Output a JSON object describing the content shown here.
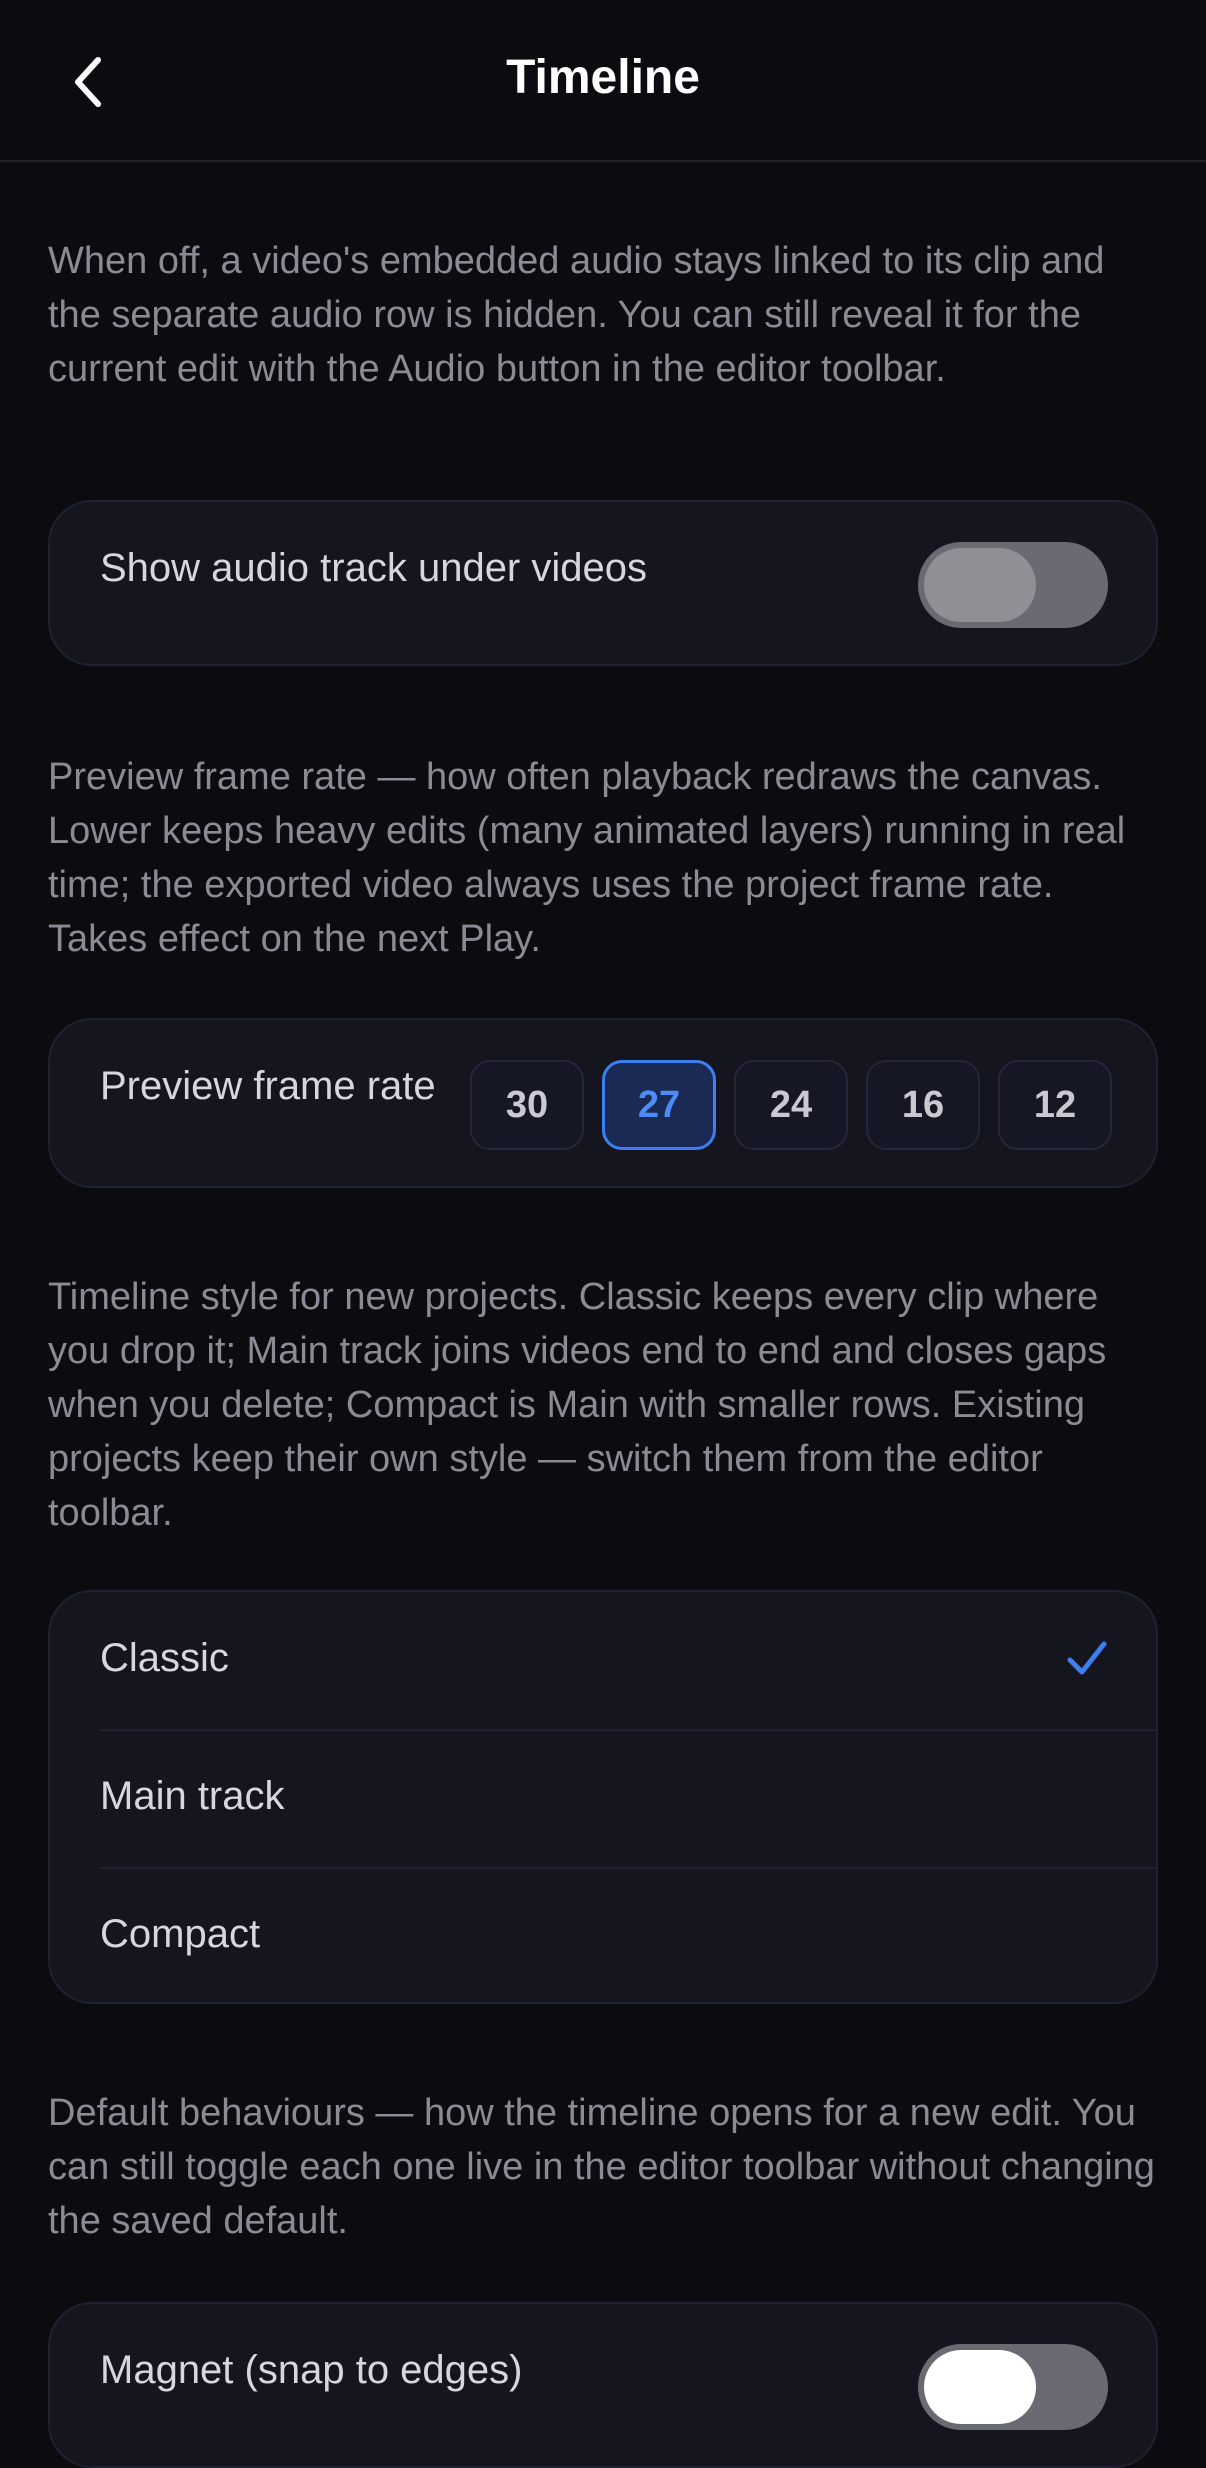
{
  "header": {
    "title": "Timeline",
    "back_icon": "chevron-left-icon"
  },
  "sections": {
    "audio": {
      "description": "When off, a video's embedded audio stays linked to its clip and the separate audio row is hidden. You can still reveal it for the current edit with the Audio button in the editor toolbar.",
      "label": "Show audio track under videos",
      "toggle_on": false
    },
    "fps": {
      "description": "Preview frame rate — how often playback redraws the canvas. Lower keeps heavy edits (many animated layers) running in real time; the exported video always uses the project frame rate. Takes effect on the next Play.",
      "label": "Preview frame rate",
      "options": [
        "30",
        "27",
        "24",
        "16",
        "12"
      ],
      "selected": "27"
    },
    "style": {
      "description": "Timeline style for new projects. Classic keeps every clip where you drop it; Main track joins videos end to end and closes gaps when you delete; Compact is Main with smaller rows. Existing projects keep their own style — switch them from the editor toolbar.",
      "options": [
        "Classic",
        "Main track",
        "Compact"
      ],
      "selected": "Classic"
    },
    "defaults": {
      "description": "Default behaviours — how the timeline opens for a new edit. You can still toggle each one live in the editor toolbar without changing the saved default.",
      "magnet_label": "Magnet (snap to edges)",
      "magnet_on": true
    }
  },
  "colors": {
    "accent": "#3d7ef0",
    "background": "#0b0b10",
    "card": "#14151f",
    "secondary_text": "#8b8b96"
  }
}
